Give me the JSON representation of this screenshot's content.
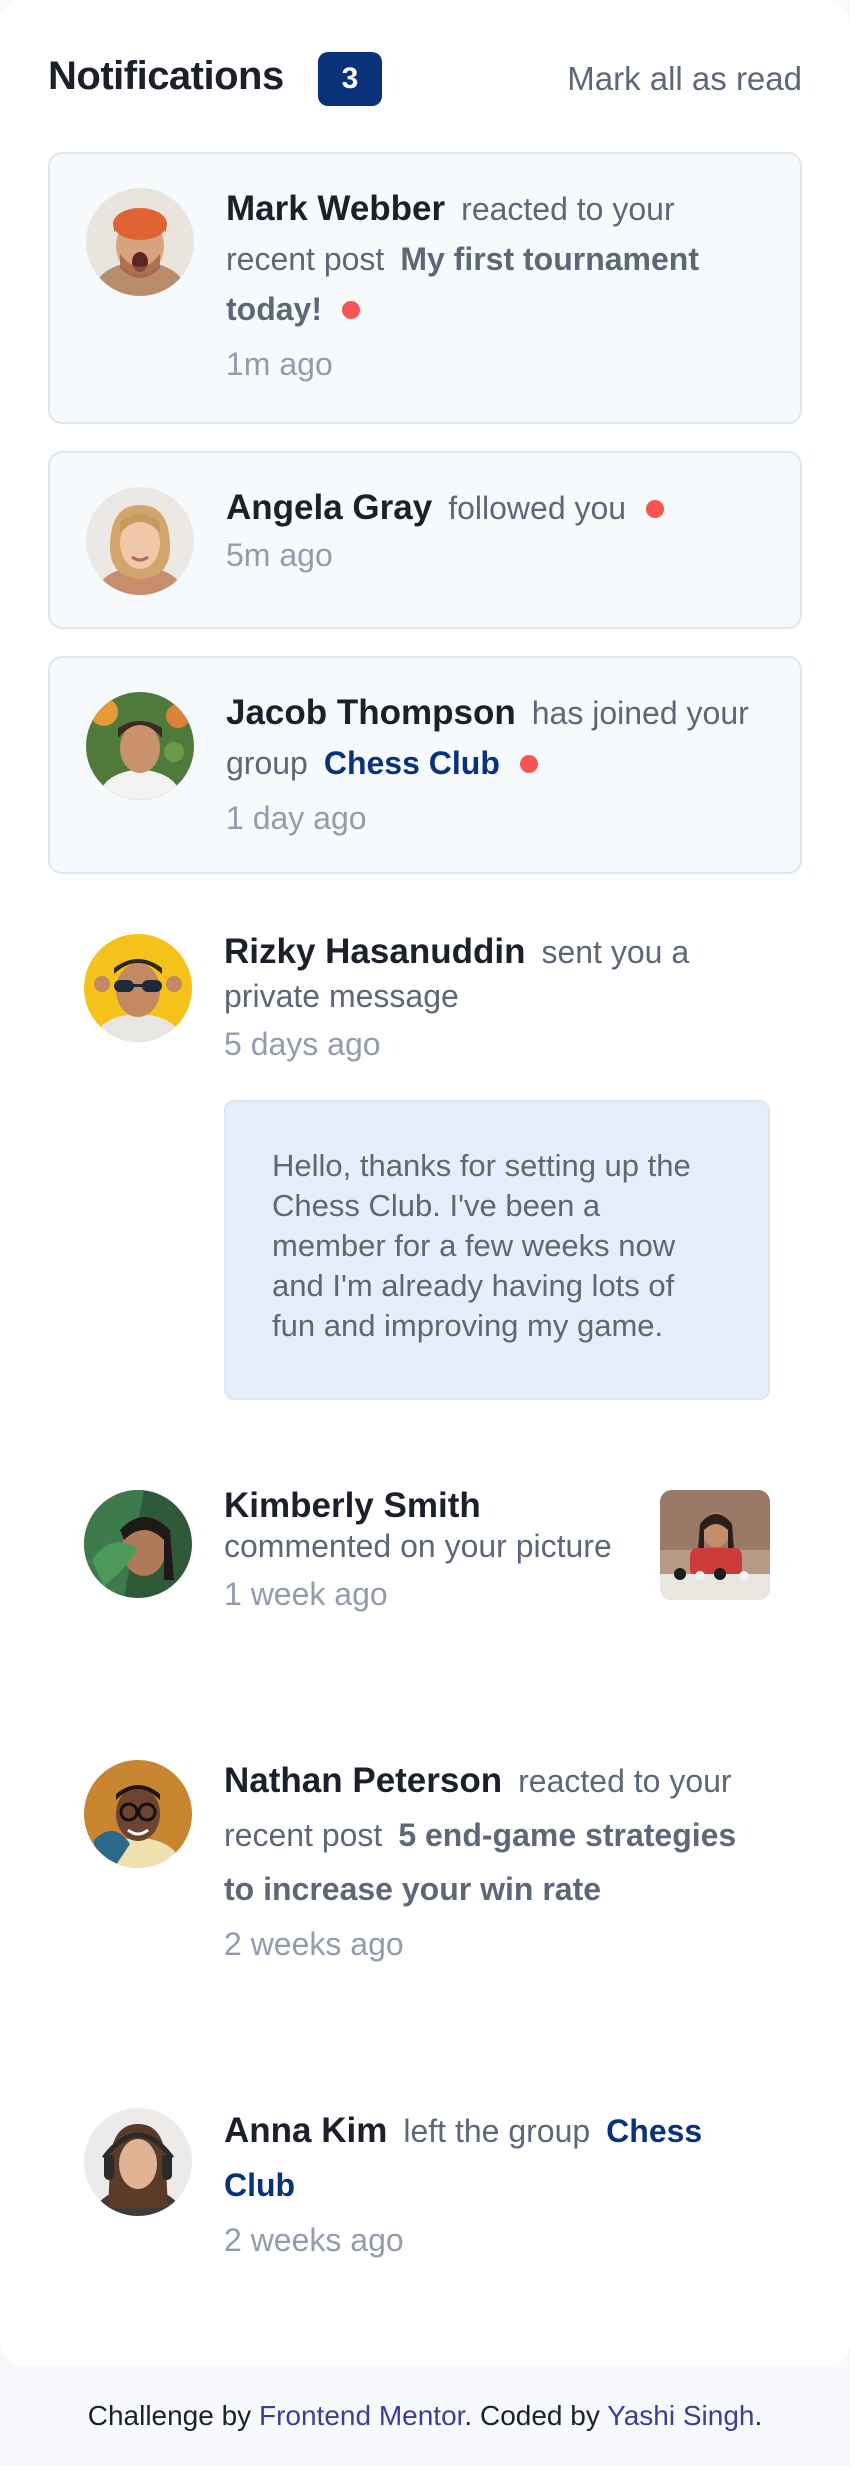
{
  "header": {
    "title": "Notifications",
    "badge_count": "3",
    "mark_all": "Mark all as read"
  },
  "notifications": [
    {
      "name": "Mark Webber",
      "action": "reacted to your recent post",
      "post": "My first tournament today!",
      "time": "1m ago",
      "unread": true,
      "avatar": "mark-webber-avatar"
    },
    {
      "name": "Angela Gray",
      "action": "followed you",
      "time": "5m ago",
      "unread": true,
      "avatar": "angela-gray-avatar"
    },
    {
      "name": "Jacob Thompson",
      "action": "has joined your group",
      "group": "Chess Club",
      "time": "1 day ago",
      "unread": true,
      "avatar": "jacob-thompson-avatar"
    },
    {
      "name": "Rizky Hasanuddin",
      "action": "sent you a private message",
      "time": "5 days ago",
      "message": "Hello, thanks for setting up the Chess Club. I've been a member for a few weeks now and I'm already having lots of fun and improving my game.",
      "unread": false,
      "avatar": "rizky-hasanuddin-avatar"
    },
    {
      "name": "Kimberly Smith",
      "action": "commented on your picture",
      "time": "1 week ago",
      "unread": false,
      "avatar": "kimberly-smith-avatar",
      "picture": "chess-picture-thumbnail"
    },
    {
      "name": "Nathan Peterson",
      "action": "reacted to your recent post",
      "post": "5 end-game strategies to increase your win rate",
      "time": "2 weeks ago",
      "unread": false,
      "avatar": "nathan-peterson-avatar"
    },
    {
      "name": "Anna Kim",
      "action": "left the group",
      "group": "Chess Club",
      "time": "2 weeks ago",
      "unread": false,
      "avatar": "anna-kim-avatar"
    }
  ],
  "footer": {
    "prefix": "Challenge by",
    "link1": "Frontend Mentor",
    "middle": ". Coded by",
    "link2": "Yashi Singh",
    "suffix": "."
  },
  "colors": {
    "accent": "#0a327b",
    "unread_dot": "#f65552",
    "unread_bg": "#f7fafd",
    "message_bg": "#e5effa"
  }
}
